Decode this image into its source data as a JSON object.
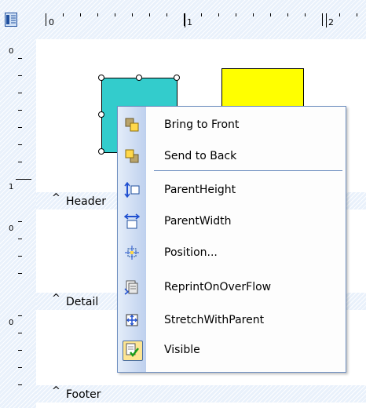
{
  "ruler": {
    "horizontal_labels": [
      "0",
      "1",
      "2"
    ],
    "vertical_labels": [
      "0",
      "1",
      "0",
      "0"
    ]
  },
  "sections": [
    {
      "caret": "^",
      "label": "Header"
    },
    {
      "caret": "^",
      "label": "Detail"
    },
    {
      "caret": "^",
      "label": "Footer"
    }
  ],
  "shapes": {
    "teal_color": "#33cccc",
    "yellow_color": "#ffff00"
  },
  "context_menu": {
    "items": [
      {
        "label": "Bring to Front",
        "icon": "bring-to-front-icon"
      },
      {
        "label": "Send to Back",
        "icon": "send-to-back-icon"
      },
      {
        "label": "ParentHeight",
        "icon": "parent-height-icon"
      },
      {
        "label": "ParentWidth",
        "icon": "parent-width-icon"
      },
      {
        "label": "Position...",
        "icon": "position-icon"
      },
      {
        "label": "ReprintOnOverFlow",
        "icon": "reprint-icon"
      },
      {
        "label": "StretchWithParent",
        "icon": "stretch-icon"
      },
      {
        "label": "Visible",
        "icon": "visible-check-icon",
        "checked": true
      }
    ]
  }
}
